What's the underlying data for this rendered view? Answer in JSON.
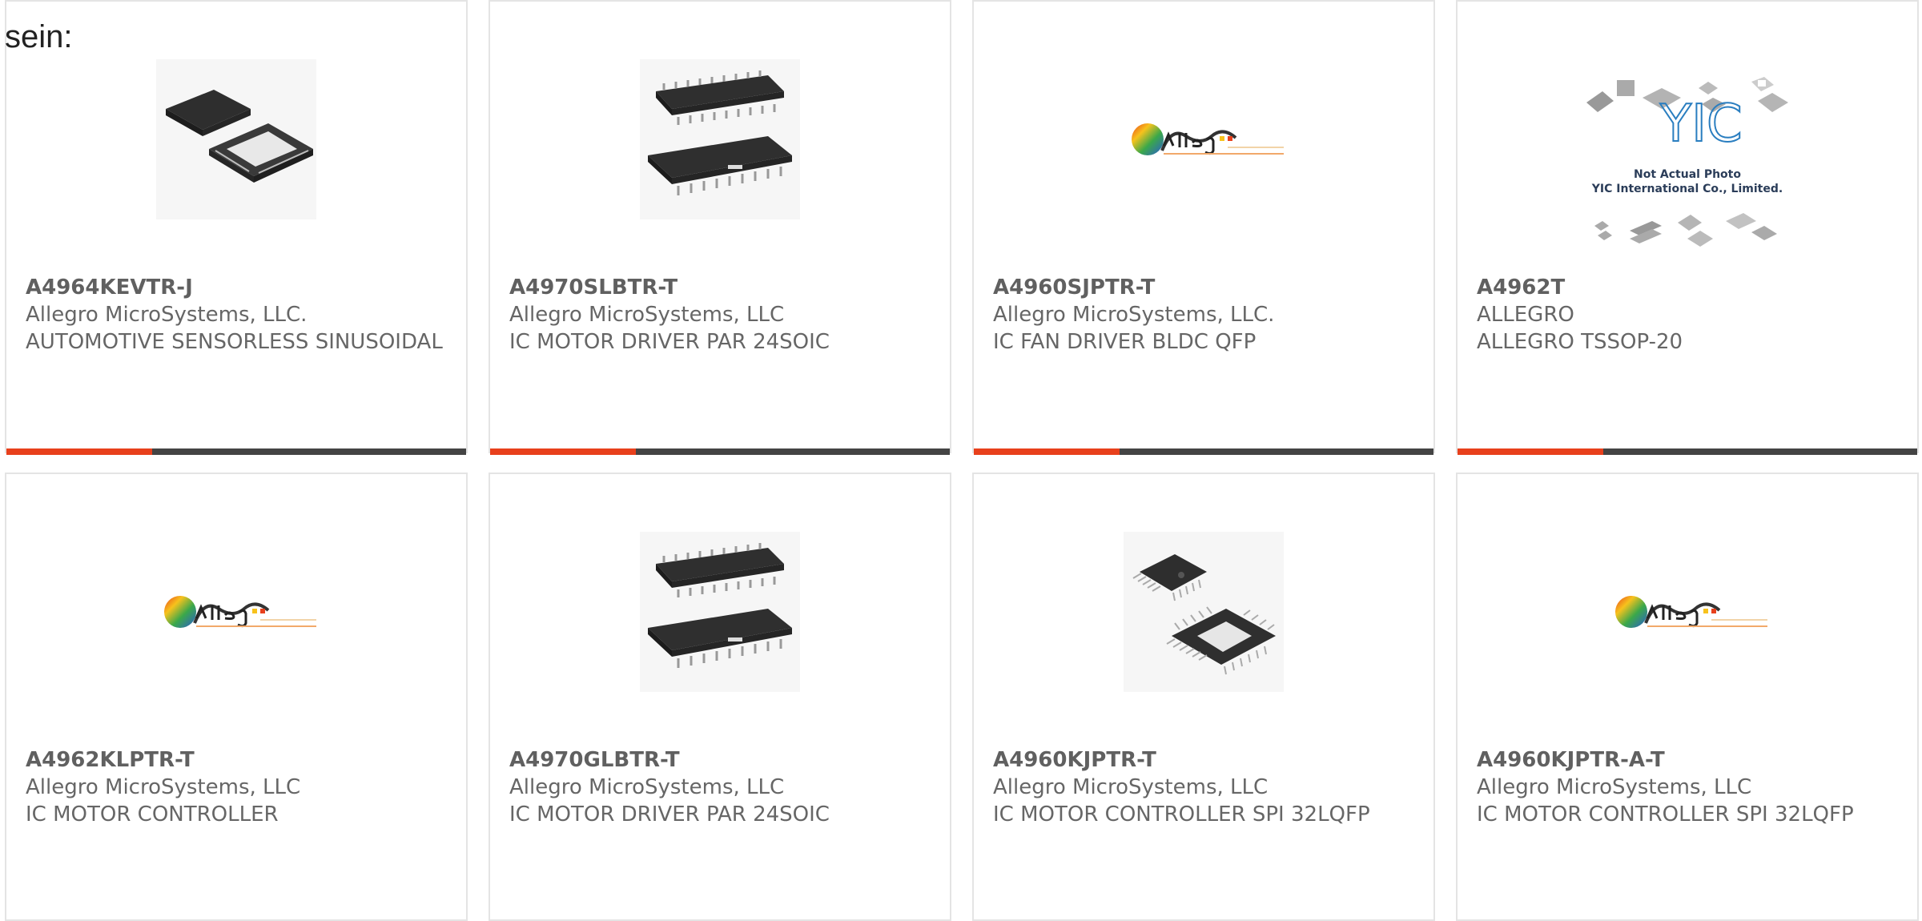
{
  "intro_text": "sein:",
  "colors": {
    "accent": "#e8401c",
    "bar_dark": "#444444",
    "border": "#e4e4e4",
    "text": "#666666"
  },
  "products": [
    {
      "part_number": "A4964KEVTR-J",
      "manufacturer": "Allegro MicroSystems, LLC.",
      "description": "AUTOMOTIVE SENSORLESS SINUSOIDAL",
      "image": "qfn-chip-icon"
    },
    {
      "part_number": "A4970SLBTR-T",
      "manufacturer": "Allegro MicroSystems, LLC",
      "description": "IC MOTOR DRIVER PAR 24SOIC",
      "image": "soic-chip-icon"
    },
    {
      "part_number": "A4960SJPTR-T",
      "manufacturer": "Allegro MicroSystems, LLC.",
      "description": "IC FAN DRIVER BLDC QFP",
      "image": "allegro-logo"
    },
    {
      "part_number": "A4962T",
      "manufacturer": "ALLEGRO",
      "description": "ALLEGRO TSSOP-20",
      "image": "yic-placeholder",
      "image_text_1": "Not Actual Photo",
      "image_text_2": "YIC International Co., Limited."
    },
    {
      "part_number": "A4962KLPTR-T",
      "manufacturer": "Allegro MicroSystems, LLC",
      "description": "IC MOTOR CONTROLLER",
      "image": "allegro-logo"
    },
    {
      "part_number": "A4970GLBTR-T",
      "manufacturer": "Allegro MicroSystems, LLC",
      "description": "IC MOTOR DRIVER PAR 24SOIC",
      "image": "soic-chip-icon"
    },
    {
      "part_number": "A4960KJPTR-T",
      "manufacturer": "Allegro MicroSystems, LLC",
      "description": "IC MOTOR CONTROLLER SPI 32LQFP",
      "image": "lqfp-chip-icon"
    },
    {
      "part_number": "A4960KJPTR-A-T",
      "manufacturer": "Allegro MicroSystems, LLC",
      "description": "IC MOTOR CONTROLLER SPI 32LQFP",
      "image": "allegro-logo"
    }
  ]
}
